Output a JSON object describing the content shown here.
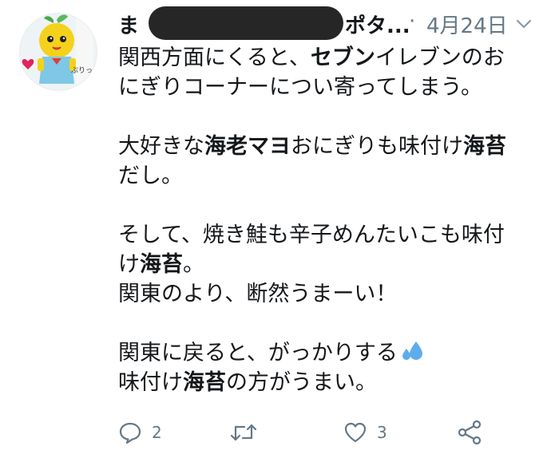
{
  "tweet": {
    "author_name_start": "ま",
    "author_name_end": "ポタ...",
    "separator": "·",
    "date": "4月24日",
    "body": [
      [
        [
          {
            "t": "関西方面にくると、"
          },
          {
            "t": "セブン",
            "b": true
          },
          {
            "t": "イレブンのお"
          }
        ],
        [
          {
            "t": "にぎりコーナーについ寄ってしまう。"
          }
        ]
      ],
      [
        [
          {
            "t": "大好きな"
          },
          {
            "t": "海老マヨ",
            "b": true
          },
          {
            "t": "おにぎりも味付け"
          },
          {
            "t": "海苔",
            "b": true
          }
        ],
        [
          {
            "t": "だし。"
          }
        ]
      ],
      [
        [
          {
            "t": "そして、焼き鮭も辛子めんたいこも味付"
          }
        ],
        [
          {
            "t": "け"
          },
          {
            "t": "海苔",
            "b": true
          },
          {
            "t": "。"
          }
        ],
        [
          {
            "t": "関東のより、断然うまーい！"
          }
        ]
      ],
      [
        [
          {
            "t": "関東に戻ると、がっかりする"
          },
          {
            "emoji": "sweat-droplets-icon"
          }
        ],
        [
          {
            "t": "味付け"
          },
          {
            "t": "海苔",
            "b": true
          },
          {
            "t": "の方がうまい。"
          }
        ]
      ]
    ],
    "actions": {
      "reply_count": "2",
      "retweet_count": "",
      "like_count": "3"
    }
  },
  "colors": {
    "text": "#14171a",
    "secondary": "#657786",
    "emoji": "#5dadec"
  }
}
